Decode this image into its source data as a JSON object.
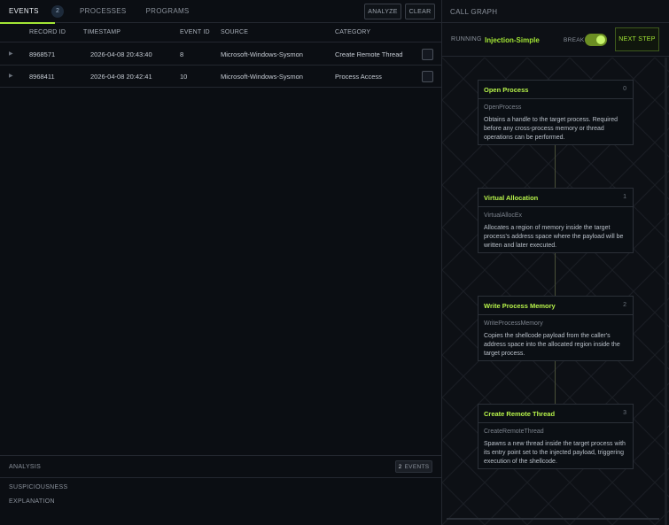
{
  "tabs": [
    {
      "label": "EVENTS",
      "count": "2"
    },
    {
      "label": "PROCESSES"
    },
    {
      "label": "PROGRAMS"
    }
  ],
  "toolbar": {
    "analyze_label": "ANALYZE",
    "clear_label": "CLEAR"
  },
  "table": {
    "columns": [
      "RECORD ID",
      "TIMESTAMP",
      "EVENT ID",
      "SOURCE",
      "CATEGORY"
    ],
    "rows": [
      {
        "record_id": "8968571",
        "timestamp": "2026-04-08 20:43:40",
        "event_id": "8",
        "source": "Microsoft-Windows-Sysmon",
        "category": "Create Remote Thread",
        "checked": false
      },
      {
        "record_id": "8968411",
        "timestamp": "2026-04-08 20:42:41",
        "event_id": "10",
        "source": "Microsoft-Windows-Sysmon",
        "category": "Process Access",
        "checked": false
      }
    ]
  },
  "analysis": {
    "title": "ANALYSIS",
    "events_count": "2",
    "events_label": "EVENTS",
    "suspiciousness_label": "SUSPICIOUSNESS",
    "explanation_label": "EXPLANATION"
  },
  "call_graph": {
    "title": "CALL GRAPH",
    "running_label": "RUNNING",
    "running_name": "Injection-Simple",
    "break_label": "BREAK",
    "break_enabled": true,
    "next_step_label": "NEXT STEP",
    "nodes": [
      {
        "title": "Open Process",
        "index": "0",
        "function": "OpenProcess",
        "description": "Obtains a handle to the target process. Required before any cross-process memory or thread operations can be performed."
      },
      {
        "title": "Virtual Allocation",
        "index": "1",
        "function": "VirtualAllocEx",
        "description": "Allocates a region of memory inside the target process's address space where the payload will be written and later executed."
      },
      {
        "title": "Write Process Memory",
        "index": "2",
        "function": "WriteProcessMemory",
        "description": "Copies the shellcode payload from the caller's address space into the allocated region inside the target process."
      },
      {
        "title": "Create Remote Thread",
        "index": "3",
        "function": "CreateRemoteThread",
        "description": "Spawns a new thread inside the target process with its entry point set to the injected payload, triggering execution of the shellcode."
      }
    ]
  },
  "colors": {
    "accent": "#a3e635",
    "background": "#0b0e13",
    "border": "#23272f"
  }
}
